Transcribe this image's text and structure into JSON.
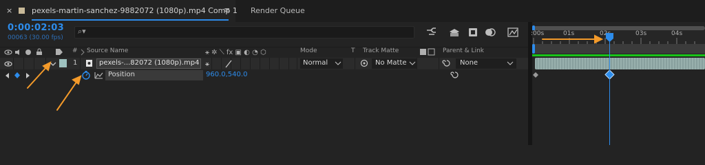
{
  "tabs": {
    "close_glyph": "×",
    "comp_title": "pexels-martin-sanchez-9882072 (1080p).mp4 Comp 1",
    "menu_glyph": "≡",
    "render_queue": "Render Queue"
  },
  "timecode": {
    "current": "0:00:02:03",
    "frames": "00063 (30.00 fps)"
  },
  "search": {
    "icon": "search-icon",
    "glyph": "⌕▾"
  },
  "columns": {
    "source_name": "Source Name",
    "hash": "#",
    "mode": "Mode",
    "t": "T",
    "track_matte": "Track Matte",
    "parent_link": "Parent & Link"
  },
  "layer": {
    "number": "1",
    "name": "pexels-...82072 (1080p).mp4",
    "mode": "Normal",
    "track_matte": "No Matte",
    "parent": "None"
  },
  "property": {
    "name": "Position",
    "value": "960.0,540.0"
  },
  "ruler": {
    "ticks": [
      ":00s",
      "01s",
      "02s",
      "03s",
      "04s"
    ]
  },
  "colors": {
    "accent": "#2d8ceb",
    "annotation_arrow": "#f39a2a",
    "layer_bar": "#8fa9a6",
    "label_swatch": "#9ec2c0",
    "work_area": "#19c419"
  }
}
